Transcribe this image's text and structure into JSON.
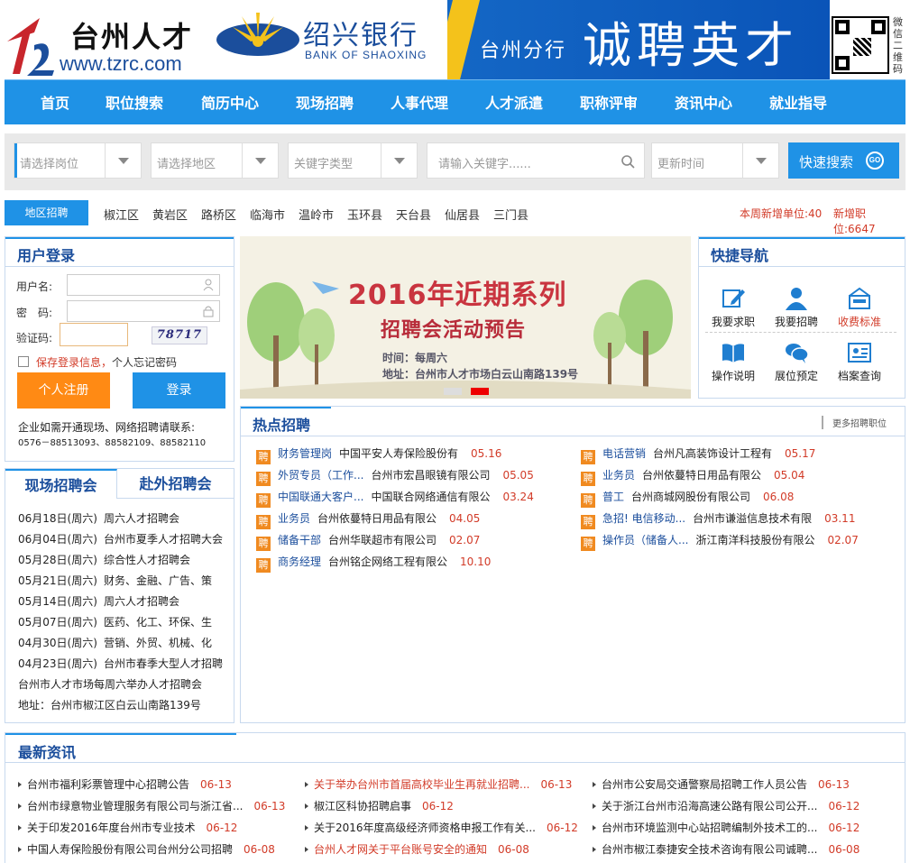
{
  "header": {
    "logo_title": "台州人才",
    "logo_url": "www.tzrc.com",
    "bank_cn": "绍兴银行",
    "bank_en": "BANK OF SHAOXING",
    "banner_sub": "台州分行",
    "banner_main": "诚聘英才",
    "qr_label": "微信二维码"
  },
  "nav": [
    "首页",
    "职位搜索",
    "简历中心",
    "现场招聘",
    "人事代理",
    "人才派遣",
    "职称评审",
    "资讯中心",
    "就业指导"
  ],
  "search": {
    "position_placeholder": "请选择岗位",
    "area_placeholder": "请选择地区",
    "keyword_type_placeholder": "关键字类型",
    "keyword_placeholder": "请输入关键字......",
    "time_placeholder": "更新时间",
    "button": "快速搜索",
    "button_icon": "GO"
  },
  "district": {
    "tab": "地区招聘",
    "links": [
      "椒江区",
      "黄岩区",
      "路桥区",
      "临海市",
      "温岭市",
      "玉环县",
      "天台县",
      "仙居县",
      "三门县"
    ],
    "new_units": "本周新增单位:40",
    "new_jobs": "新增职位:6647"
  },
  "login": {
    "title": "用户登录",
    "username_label": "用户名:",
    "password_label": "密　码:",
    "captcha_label": "验证码:",
    "captcha_value": "78717",
    "remember_red": "保存登录信息，",
    "forgot": "个人忘记密码",
    "register_button": "个人注册",
    "login_button": "登录",
    "contact_line1": "企业如需开通现场、网络招聘请联系:",
    "contact_phones": "0576－88513093、88582109、88582110"
  },
  "fairs": {
    "tab_local": "现场招聘会",
    "tab_away": "赴外招聘会",
    "items": [
      {
        "date": "06月18日(周六)",
        "name": "周六人才招聘会"
      },
      {
        "date": "06月04日(周六)",
        "name": "台州市夏季人才招聘大会"
      },
      {
        "date": "05月28日(周六)",
        "name": "综合性人才招聘会"
      },
      {
        "date": "05月21日(周六)",
        "name": "财务、金融、广告、策"
      },
      {
        "date": "05月14日(周六)",
        "name": "周六人才招聘会"
      },
      {
        "date": "05月07日(周六)",
        "name": "医药、化工、环保、生"
      },
      {
        "date": "04月30日(周六)",
        "name": "营销、外贸、机械、化"
      },
      {
        "date": "04月23日(周六)",
        "name": "台州市春季大型人才招聘"
      }
    ],
    "note1": "台州市人才市场每周六举办人才招聘会",
    "note2": "地址：台州市椒江区白云山南路139号"
  },
  "slide": {
    "title": "2016年近期系列",
    "subtitle": "招聘会活动预告",
    "time": "时间：每周六",
    "address": "地址：台州市人才市场白云山南路139号"
  },
  "quicknav": {
    "title": "快捷导航",
    "items": [
      "我要求职",
      "我要招聘",
      "收费标准",
      "操作说明",
      "展位预定",
      "档案查询"
    ]
  },
  "hot": {
    "title": "热点招聘",
    "more": "更多招聘职位",
    "tag": "聘",
    "left": [
      {
        "pos": "财务管理岗",
        "co": "中国平安人寿保险股份有",
        "date": "05.16"
      },
      {
        "pos": "外贸专员（工作...",
        "co": "台州市宏昌眼镜有限公司",
        "date": "05.05"
      },
      {
        "pos": "中国联通大客户...",
        "co": "中国联合网络通信有限公",
        "date": "03.24"
      },
      {
        "pos": "业务员",
        "co": "台州依蔓特日用品有限公",
        "date": "04.05"
      },
      {
        "pos": "储备干部",
        "co": "台州华联超市有限公司",
        "date": "02.07"
      },
      {
        "pos": "商务经理",
        "co": "台州铭企网络工程有限公",
        "date": "10.10"
      }
    ],
    "right": [
      {
        "pos": "电话营销",
        "co": "台州凡高装饰设计工程有",
        "date": "05.17"
      },
      {
        "pos": "业务员",
        "co": "台州依蔓特日用品有限公",
        "date": "05.04"
      },
      {
        "pos": "普工",
        "co": "台州商城网股份有限公司",
        "date": "06.08"
      },
      {
        "pos": "急招! 电信移动...",
        "co": "台州市谦溢信息技术有限",
        "date": "03.11"
      },
      {
        "pos": "操作员（储备人...",
        "co": "浙江南洋科技股份有限公",
        "date": "02.07"
      }
    ]
  },
  "news": {
    "title": "最新资讯",
    "cols": [
      [
        {
          "text": "台州市福利彩票管理中心招聘公告",
          "date": "06-13"
        },
        {
          "text": "台州市绿意物业管理服务有限公司与浙江省...",
          "date": "06-13"
        },
        {
          "text": "关于印发2016年度台州市专业技术",
          "date": "06-12"
        },
        {
          "text": "中国人寿保险股份有限公司台州分公司招聘",
          "date": "06-08"
        }
      ],
      [
        {
          "text": "关于举办台州市首届高校毕业生再就业招聘...",
          "date": "06-13",
          "red": true
        },
        {
          "text": "椒江区科协招聘启事",
          "date": "06-12"
        },
        {
          "text": "关于2016年度高级经济师资格申报工作有关...",
          "date": "06-12"
        },
        {
          "text": "台州人才网关于平台账号安全的通知",
          "date": "06-08",
          "red": true
        }
      ],
      [
        {
          "text": "台州市公安局交通警察局招聘工作人员公告",
          "date": "06-13"
        },
        {
          "text": "关于浙江台州市沿海高速公路有限公司公开...",
          "date": "06-12"
        },
        {
          "text": "台州市环境监测中心站招聘编制外技术工的...",
          "date": "06-12"
        },
        {
          "text": "台州市椒江泰捷安全技术咨询有限公司诚聘...",
          "date": "06-08"
        }
      ]
    ]
  },
  "colors": {
    "primary": "#1f92e6",
    "accent": "#ff8a14",
    "red": "#d23b28",
    "link": "#1b4e9c"
  }
}
